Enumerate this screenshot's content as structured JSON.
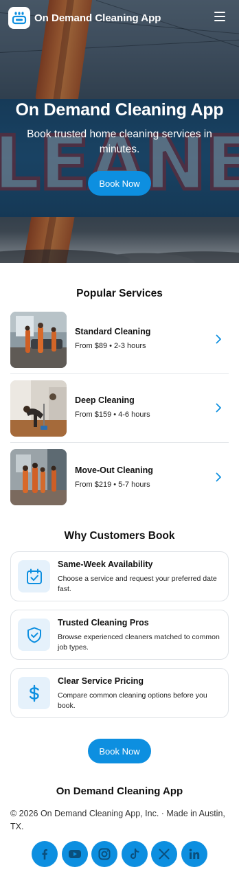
{
  "colors": {
    "accent": "#0d8fe0",
    "icon_bg": "#e5f1fb",
    "card_border": "#dfe3e7"
  },
  "nav": {
    "brand": "On Demand Cleaning App",
    "logo_icon": "cleaning-robot-icon",
    "menu_icon": "hamburger-menu-icon"
  },
  "hero": {
    "title": "On Demand Cleaning App",
    "subtitle": "Book trusted home cleaning services in minutes.",
    "cta": "Book Now"
  },
  "services": {
    "heading": "Popular Services",
    "items": [
      {
        "name": "Standard Cleaning",
        "meta": "From $89 • 2-3 hours",
        "icon": "chevron-right-icon"
      },
      {
        "name": "Deep Cleaning",
        "meta": "From $159 • 4-6 hours",
        "icon": "chevron-right-icon"
      },
      {
        "name": "Move-Out Cleaning",
        "meta": "From $219 • 5-7 hours",
        "icon": "chevron-right-icon"
      }
    ]
  },
  "features": {
    "heading": "Why Customers Book",
    "items": [
      {
        "title": "Same-Week Availability",
        "desc": "Choose a service and request your preferred date fast.",
        "icon": "calendar-check-icon"
      },
      {
        "title": "Trusted Cleaning Pros",
        "desc": "Browse experienced cleaners matched to common job types.",
        "icon": "shield-check-icon"
      },
      {
        "title": "Clear Service Pricing",
        "desc": "Compare common cleaning options before you book.",
        "icon": "dollar-sign-icon"
      }
    ]
  },
  "cta_bottom": "Book Now",
  "footer": {
    "title": "On Demand Cleaning App",
    "copyright": "© 2026 On Demand Cleaning App, Inc. · Made in Austin, TX.",
    "socials": [
      "facebook-icon",
      "youtube-icon",
      "instagram-icon",
      "tiktok-icon",
      "x-icon",
      "linkedin-icon"
    ]
  }
}
